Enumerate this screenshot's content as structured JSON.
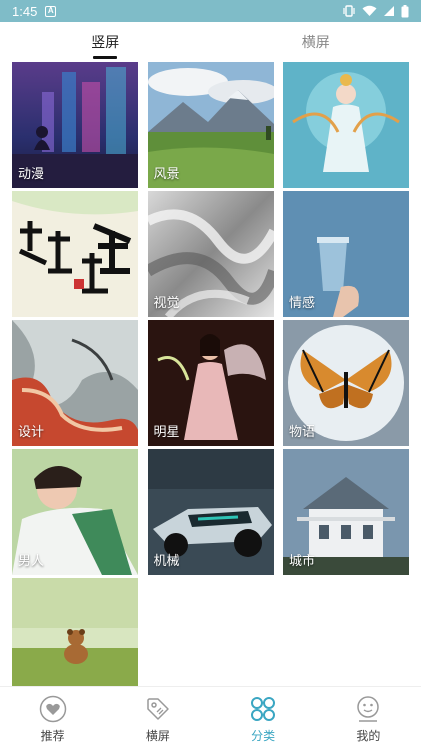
{
  "status": {
    "time": "1:45"
  },
  "tabs": [
    {
      "label": "竖屏",
      "active": true
    },
    {
      "label": "横屏",
      "active": false
    }
  ],
  "categories": [
    {
      "label": "动漫"
    },
    {
      "label": "风景"
    },
    {
      "label": ""
    },
    {
      "label": ""
    },
    {
      "label": "视觉"
    },
    {
      "label": "情感"
    },
    {
      "label": "设计"
    },
    {
      "label": "明星"
    },
    {
      "label": "物语"
    },
    {
      "label": "男人"
    },
    {
      "label": "机械"
    },
    {
      "label": "城市"
    },
    {
      "label": ""
    }
  ],
  "nav": [
    {
      "label": "推荐",
      "icon": "heart-icon"
    },
    {
      "label": "横屏",
      "icon": "tag-icon"
    },
    {
      "label": "分类",
      "icon": "grid-icon",
      "active": true
    },
    {
      "label": "我的",
      "icon": "smiley-icon"
    }
  ],
  "colors": {
    "accent": "#3aa6c2",
    "statusbar": "#7fbcc8"
  }
}
